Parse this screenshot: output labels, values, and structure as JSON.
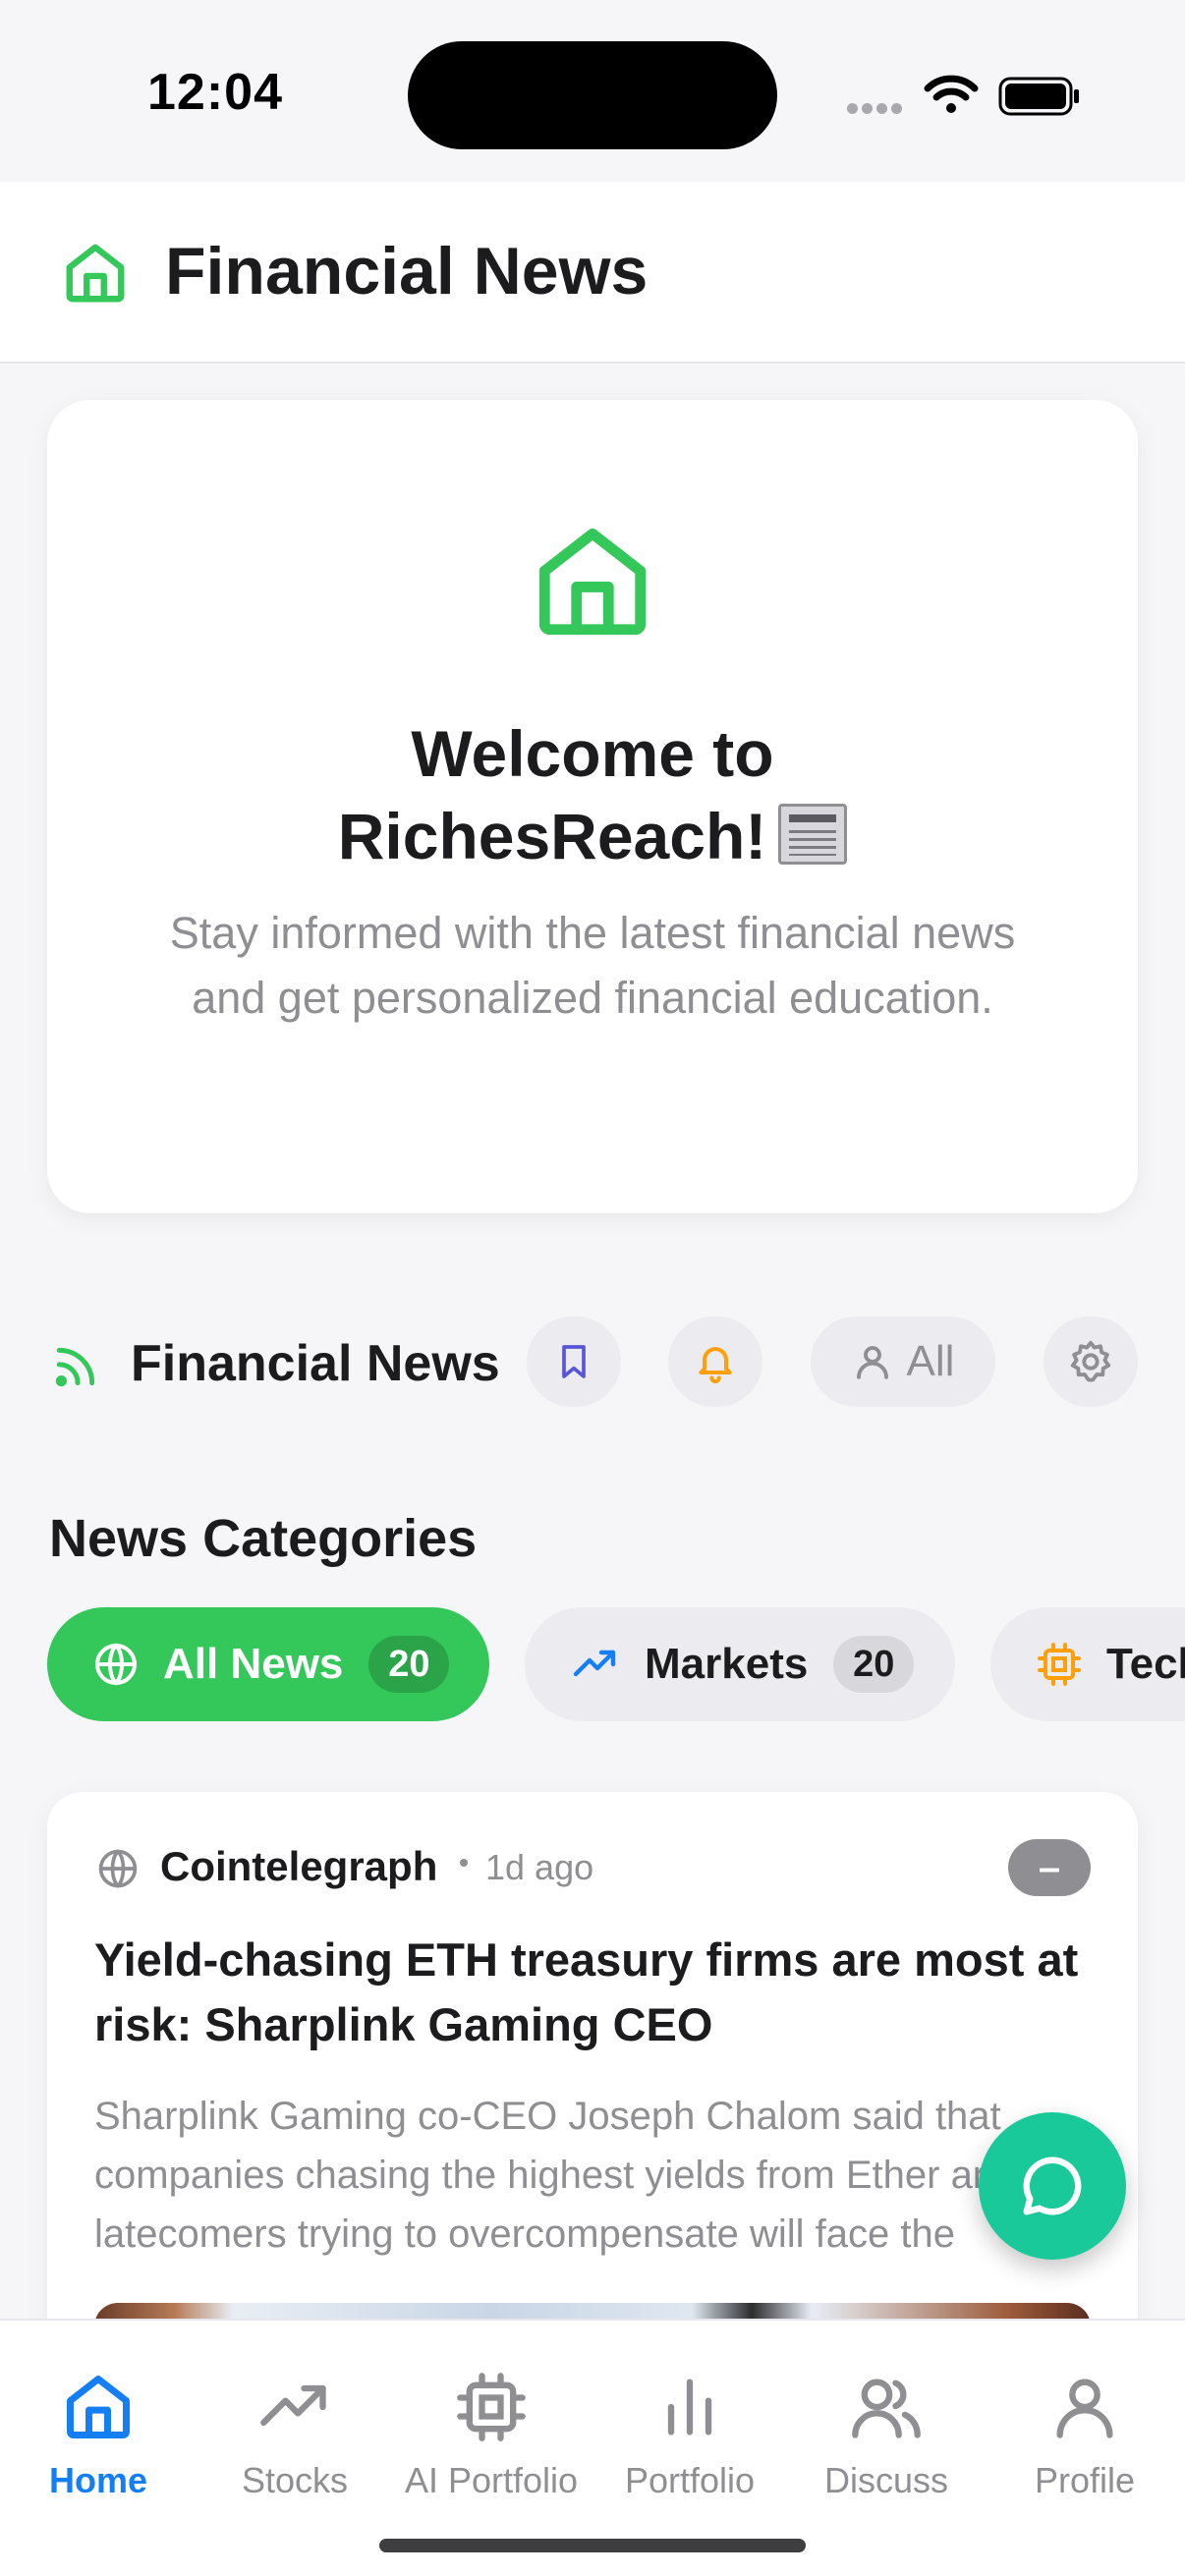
{
  "status_bar": {
    "time": "12:04",
    "icons": [
      "signal-dots-icon",
      "wifi-icon",
      "battery-icon"
    ]
  },
  "header": {
    "icon": "home-icon",
    "title": "Financial News"
  },
  "welcome": {
    "icon": "home-icon",
    "title_line1": "Welcome to",
    "title_line2": "RichesReach!",
    "title_emoji": "newspaper-emoji",
    "subtitle": "Stay informed with the latest financial news and get personalized financial education."
  },
  "news_toolbar": {
    "icon": "rss-icon",
    "title": "Financial News",
    "buttons": {
      "bookmark": "bookmark-icon",
      "notifications": "bell-icon",
      "filter_label": "All",
      "filter_icon": "user-icon",
      "settings": "gear-icon"
    }
  },
  "categories": {
    "heading": "News Categories",
    "items": [
      {
        "label": "All News",
        "count": "20",
        "icon": "globe-icon",
        "active": true
      },
      {
        "label": "Markets",
        "count": "20",
        "icon": "trending-up-icon",
        "active": false
      },
      {
        "label": "Tech",
        "count": "",
        "icon": "cpu-icon",
        "active": false
      }
    ]
  },
  "article": {
    "source": "Cointelegraph",
    "time": "1d ago",
    "badge": "–",
    "title": "Yield-chasing ETH treasury firms are most at risk: Sharplink Gaming CEO",
    "summary": "Sharplink Gaming co-CEO Joseph Chalom said that companies chasing the highest yields from Ether are latecomers trying to overcompensate will face the"
  },
  "chat_button": {
    "icon": "chat-bubble-icon"
  },
  "tab_bar": {
    "tabs": [
      {
        "label": "Home",
        "icon": "home-icon",
        "active": true
      },
      {
        "label": "Stocks",
        "icon": "trending-up-icon",
        "active": false
      },
      {
        "label": "AI Portfolio",
        "icon": "cpu-icon",
        "active": false
      },
      {
        "label": "Portfolio",
        "icon": "bar-chart-icon",
        "active": false
      },
      {
        "label": "Discuss",
        "icon": "users-icon",
        "active": false
      },
      {
        "label": "Profile",
        "icon": "user-icon",
        "active": false
      }
    ]
  },
  "colors": {
    "accent_green": "#34c759",
    "active_tab_blue": "#147ef5",
    "fab_green": "#19c999",
    "bell_orange": "#ff9f0a",
    "bookmark_indigo": "#5856d6",
    "muted_gray": "#8e8e93"
  }
}
